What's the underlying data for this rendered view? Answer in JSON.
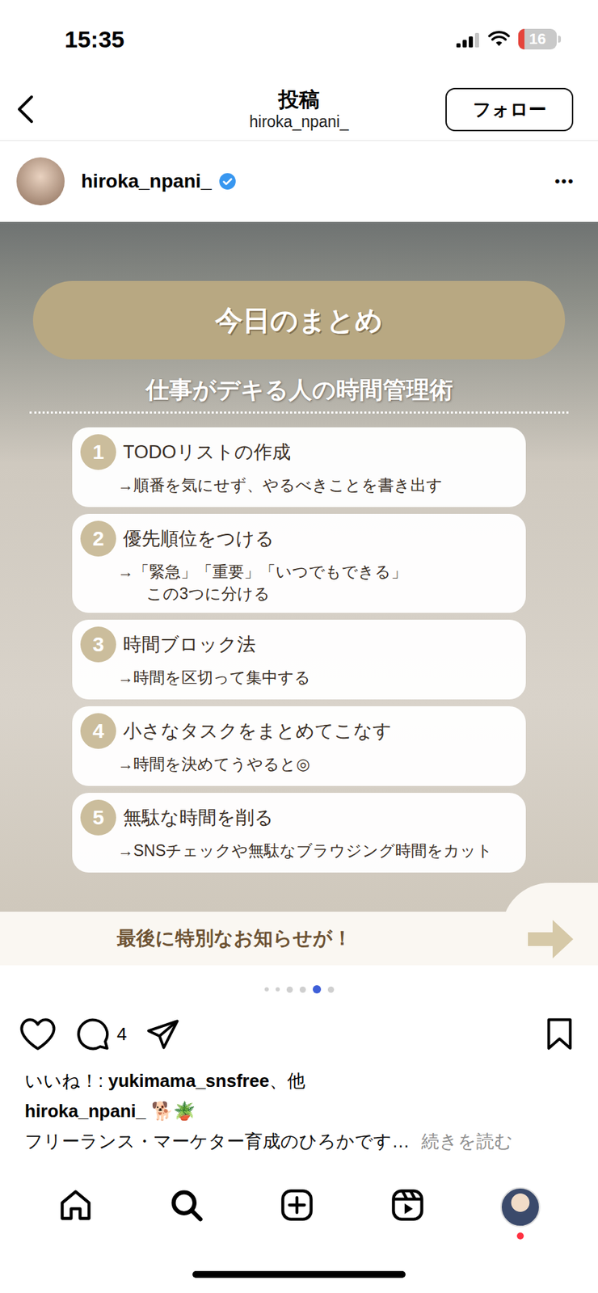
{
  "status_bar": {
    "time": "15:35",
    "battery": "16",
    "battery_level": 0.16,
    "signal_level": 0.75
  },
  "header": {
    "title": "投稿",
    "subtitle": "hiroka_npani_",
    "follow_button": "フォロー"
  },
  "author": {
    "username": "hiroka_npani_",
    "verified": true,
    "more": "•••"
  },
  "slide": {
    "title": "今日のまとめ",
    "subtitle": "仕事がデキる人の時間管理術",
    "items": [
      {
        "number": "1",
        "title": "TODOリストの作成",
        "lines": [
          "→順番を気にせず、やるべきことを書き出す"
        ]
      },
      {
        "number": "2",
        "title": "優先順位をつける",
        "lines": [
          "→「緊急」「重要」「いつでもできる」",
          "この3つに分ける"
        ]
      },
      {
        "number": "3",
        "title": "時間ブロック法",
        "lines": [
          "→時間を区切って集中する"
        ]
      },
      {
        "number": "4",
        "title": "小さなタスクをまとめてこなす",
        "lines": [
          "→時間を決めてうやると◎"
        ]
      },
      {
        "number": "5",
        "title": "無駄な時間を削る",
        "lines": [
          "→SNSチェックや無駄なブラウジング時間をカット"
        ]
      }
    ],
    "footer": "最後に特別なお知らせが！"
  },
  "carousel": {
    "dots": [
      {
        "selected": false
      },
      {
        "selected": false
      },
      {
        "selected": false
      },
      {
        "selected": false
      },
      {
        "selected": true
      },
      {
        "selected": false
      }
    ]
  },
  "actions": {
    "liked": false,
    "saved": false,
    "comment_count": "4"
  },
  "likes": {
    "prefix": "いいね！: ",
    "user": "yukimama_snsfree",
    "suffix": "、他"
  },
  "caption": {
    "username": "hiroka_npani_",
    "emoji": "🐕🪴",
    "text": "フリーランス・マーケター育成のひろかです…",
    "more": "続きを読む"
  },
  "tab_bar": {
    "profile_notification": true
  }
}
